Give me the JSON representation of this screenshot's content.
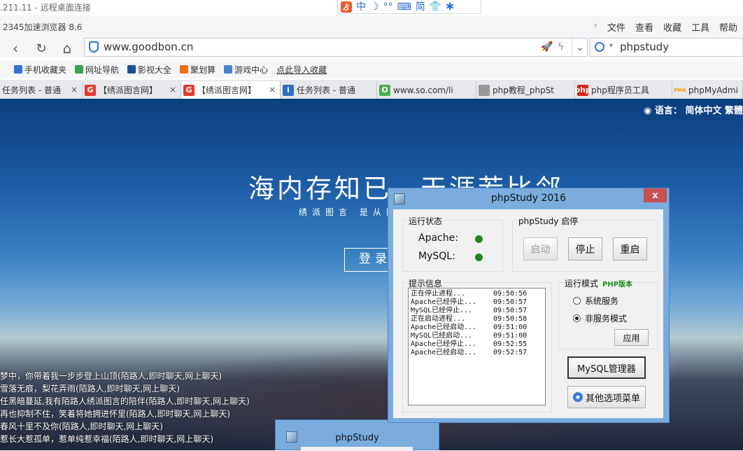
{
  "remote_desktop": {
    "title": ".211.11 - 远程桌面连接"
  },
  "ime_bar": {
    "logo": "ゟ",
    "mode": "中",
    "moon": "☽",
    "dots": "°°",
    "keyboard": "⌨",
    "simplified": "简",
    "shirt": "👕",
    "gear": "✱"
  },
  "browser": {
    "name": "2345加速浏览器 8.6",
    "menu": [
      "文件",
      "查看",
      "收藏",
      "工具",
      "帮助"
    ],
    "menu_chevron": "›",
    "back": "‹",
    "refresh": "↻",
    "home": "⌂",
    "url": "www.goodbon.cn",
    "search_query": "phpstudy",
    "bookmarks": [
      {
        "label": "手机收藏夹",
        "color": "#2d73d8"
      },
      {
        "label": "网址导航",
        "color": "#3aa24a"
      },
      {
        "label": "影视大全",
        "color": "#1b4f9e"
      },
      {
        "label": "聚划算",
        "color": "#ef6c1a"
      },
      {
        "label": "游戏中心",
        "color": "#4a7fd0"
      },
      {
        "label": "点此导入收藏",
        "color": ""
      }
    ],
    "tabs": [
      {
        "label": "任务列表 - 普通",
        "fav": "",
        "fav_color": "",
        "active": false
      },
      {
        "label": "【绣派图言网】",
        "fav": "G",
        "fav_color": "#e23b2e",
        "active": false
      },
      {
        "label": "【绣派图言网】",
        "fav": "G",
        "fav_color": "#e23b2e",
        "active": true
      },
      {
        "label": "任务列表 - 普通",
        "fav": "i",
        "fav_color": "#2f6fc7",
        "active": false
      },
      {
        "label": "www.so.com/li",
        "fav": "O",
        "fav_color": "#4cae4c",
        "active": false
      },
      {
        "label": "php教程_phpSt",
        "fav": "",
        "fav_color": "#999999",
        "active": false
      },
      {
        "label": "php程序员工具",
        "fav": "php",
        "fav_color": "#d9251d",
        "active": false
      },
      {
        "label": "phpMyAdmi",
        "fav": "PMA",
        "fav_color": "#f29b11",
        "active": false
      }
    ],
    "tab_close": "×"
  },
  "page": {
    "language_label": "语言：",
    "language_options": "简体中文 繁體",
    "headline": "海内存知已，天涯若比邻",
    "subtitle": "绣派图言 是从网",
    "login_button": "登录",
    "messages": [
      "梦中，你带着我一步步登上山顶(陌路人,即时聊天,网上聊天)",
      "雪落无痕，梨花弄雨(陌路人,即时聊天,网上聊天)",
      "任黑暗蔓延,我有陌路人绣派图言的陪伴(陌路人,即时聊天,网上聊天)",
      "再也抑制不住，笑着将她拥进怀里(陌路人,即时聊天,网上聊天)",
      "春风十里不及你(陌路人,即时聊天,网上聊天)",
      "惹长大惹孤单，惹单纯惹幸福(陌路人,即时聊天,网上聊天)"
    ]
  },
  "phpstudy": {
    "title": "phpStudy 2016",
    "close": "x",
    "status_group": "运行状态",
    "apache_label": "Apache:",
    "mysql_label": "MySQL:",
    "status_color": "#1b8a1b",
    "control_group": "phpStudy 启停",
    "start": "启动",
    "stop": "停止",
    "restart": "重启",
    "log_group": "提示信息",
    "log": [
      {
        "msg": "正在停止进程...",
        "time": "09:50:56"
      },
      {
        "msg": "Apache已经停止...",
        "time": "09:50:57"
      },
      {
        "msg": "MySQL已经停止...",
        "time": "09:50:57"
      },
      {
        "msg": "正在启动进程...",
        "time": "09:50:58"
      },
      {
        "msg": "Apache已经启动...",
        "time": "09:51:00"
      },
      {
        "msg": "MySQL已经启动...",
        "time": "09:51:00"
      },
      {
        "msg": "Apache已经停止...",
        "time": "09:52:55"
      },
      {
        "msg": "Apache已经启动...",
        "time": "09:52:57"
      }
    ],
    "mode_group": "运行模式",
    "php_version": "PHP版本",
    "mode_system": "系统服务",
    "mode_nonservice": "非服务模式",
    "apply": "应用",
    "mysql_manager": "MySQL管理器",
    "other_menu": "其他选项菜单"
  },
  "phpstudy_background": {
    "title": "phpStudy"
  }
}
